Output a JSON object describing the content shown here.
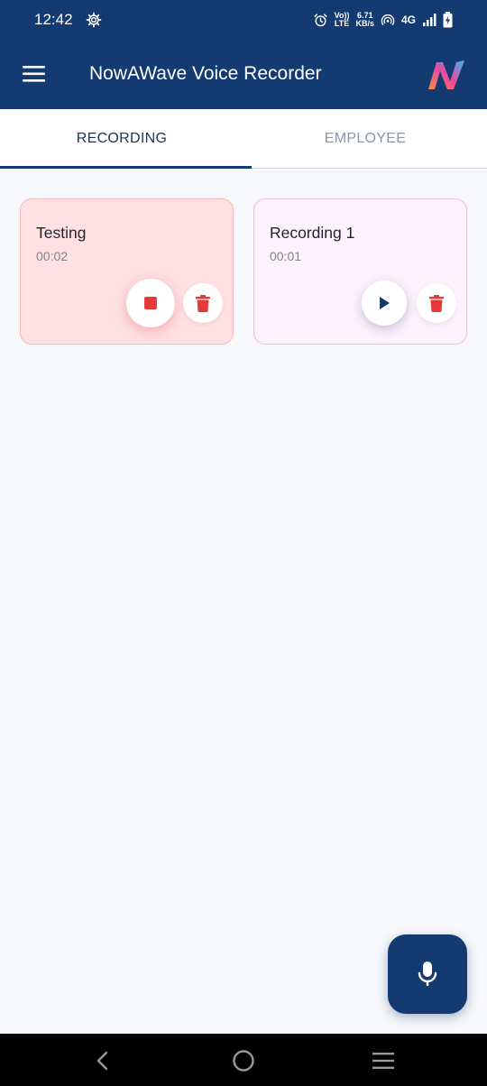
{
  "status_bar": {
    "time": "12:42",
    "net_top": "6.71",
    "net_bottom": "KB/s",
    "volte_top": "Vo))",
    "volte_bottom": "LTE",
    "network": "4G"
  },
  "app_bar": {
    "title": "NowAWave Voice Recorder",
    "menu_icon": "hamburger-menu-icon",
    "logo_icon": "nowawave-logo"
  },
  "tabs": [
    {
      "label": "RECORDING",
      "active": true
    },
    {
      "label": "EMPLOYEE",
      "active": false
    }
  ],
  "recordings": [
    {
      "title": "Testing",
      "duration": "00:02",
      "state": "recording",
      "color": "#ffe1e2"
    },
    {
      "title": "Recording 1",
      "duration": "00:01",
      "state": "stopped",
      "color": "#fdf2fc"
    }
  ],
  "fab": {
    "icon": "microphone-icon"
  },
  "colors": {
    "primary": "#143a72",
    "danger": "#e5393b",
    "background": "#f7f8fb"
  },
  "nav_bar": {
    "back_icon": "back-chevron-icon",
    "home_icon": "home-circle-icon",
    "recents_icon": "recents-menu-icon"
  }
}
